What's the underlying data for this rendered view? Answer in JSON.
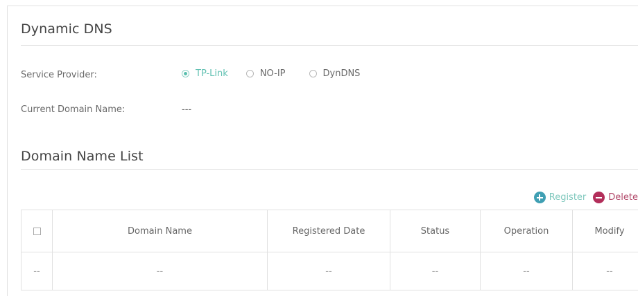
{
  "dynamic_dns": {
    "title": "Dynamic DNS",
    "service_provider_label": "Service Provider:",
    "providers": [
      {
        "label": "TP-Link",
        "selected": true
      },
      {
        "label": "NO-IP",
        "selected": false
      },
      {
        "label": "DynDNS",
        "selected": false
      }
    ],
    "current_domain_label": "Current Domain Name:",
    "current_domain_value": "---"
  },
  "domain_list": {
    "title": "Domain Name List",
    "actions": {
      "register_label": "Register",
      "delete_label": "Delete",
      "register_icon": "plus-circle-icon",
      "delete_icon": "minus-circle-icon"
    },
    "columns": [
      "Domain Name",
      "Registered Date",
      "Status",
      "Operation",
      "Modify"
    ],
    "rows": [
      {
        "select": "--",
        "domain_name": "--",
        "registered_date": "--",
        "status": "--",
        "operation": "--",
        "modify": "--"
      }
    ]
  },
  "colors": {
    "accent": "#5bbfae",
    "register": "#3f9fb3",
    "delete": "#b22e5a"
  }
}
